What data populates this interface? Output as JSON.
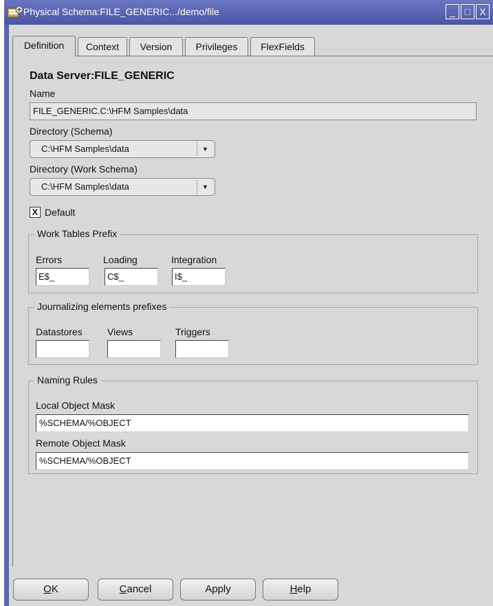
{
  "window": {
    "title": "Physical Schema:FILE_GENERIC.../demo/file",
    "minimize_glyph": "_",
    "maximize_glyph": "□",
    "close_glyph": "X",
    "icon": "schema-icon"
  },
  "tabs": [
    {
      "label": "Definition",
      "active": true
    },
    {
      "label": "Context"
    },
    {
      "label": "Version"
    },
    {
      "label": "Privileges"
    },
    {
      "label": "FlexFields"
    }
  ],
  "definition": {
    "heading": "Data Server:FILE_GENERIC",
    "name_label": "Name",
    "name_value": "FILE_GENERIC.C:\\HFM Samples\\data",
    "directory_schema_label": "Directory (Schema)",
    "directory_schema_value": "C:\\HFM Samples\\data",
    "directory_work_label": "Directory (Work Schema)",
    "directory_work_value": "C:\\HFM Samples\\data",
    "default_label": "Default",
    "default_checked": true,
    "default_mark": "X"
  },
  "work_tables": {
    "title": "Work Tables Prefix",
    "errors_label": "Errors",
    "errors_value": "E$_",
    "loading_label": "Loading",
    "loading_value": "C$_",
    "integration_label": "Integration",
    "integration_value": "I$_"
  },
  "journalizing": {
    "title": "Journalizing elements prefixes",
    "datastores_label": "Datastores",
    "datastores_value": "",
    "views_label": "Views",
    "views_value": "",
    "triggers_label": "Triggers",
    "triggers_value": ""
  },
  "naming_rules": {
    "title": "Naming Rules",
    "local_label": "Local Object Mask",
    "local_value": "%SCHEMA/%OBJECT",
    "remote_label": "Remote Object Mask",
    "remote_value": "%SCHEMA/%OBJECT"
  },
  "buttons": {
    "ok_mnemonic": "O",
    "ok_rest": "K",
    "cancel_mnemonic": "C",
    "cancel_rest": "ancel",
    "apply": "Apply",
    "help_mnemonic": "H",
    "help_rest": "elp"
  },
  "colors": {
    "titlebar": "#5a67ad",
    "dialog_background": "#d8d8d8"
  }
}
